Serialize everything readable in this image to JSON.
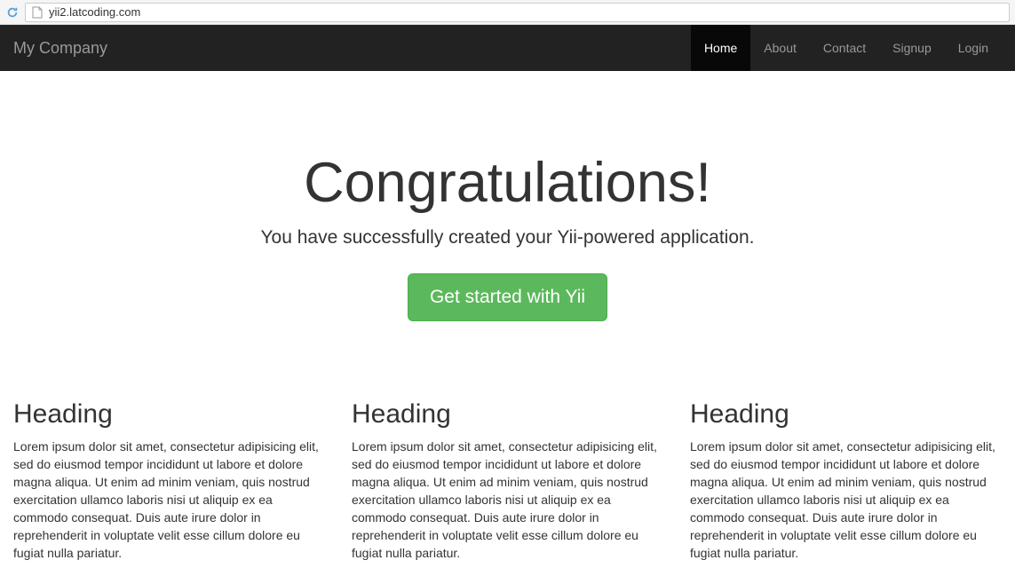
{
  "browser": {
    "url": "yii2.latcoding.com"
  },
  "navbar": {
    "brand": "My Company",
    "items": [
      {
        "label": "Home",
        "active": true
      },
      {
        "label": "About",
        "active": false
      },
      {
        "label": "Contact",
        "active": false
      },
      {
        "label": "Signup",
        "active": false
      },
      {
        "label": "Login",
        "active": false
      }
    ]
  },
  "jumbotron": {
    "title": "Congratulations!",
    "lead": "You have successfully created your Yii-powered application.",
    "cta": "Get started with Yii"
  },
  "columns": [
    {
      "heading": "Heading",
      "text": "Lorem ipsum dolor sit amet, consectetur adipisicing elit, sed do eiusmod tempor incididunt ut labore et dolore magna aliqua. Ut enim ad minim veniam, quis nostrud exercitation ullamco laboris nisi ut aliquip ex ea commodo consequat. Duis aute irure dolor in reprehenderit in voluptate velit esse cillum dolore eu fugiat nulla pariatur."
    },
    {
      "heading": "Heading",
      "text": "Lorem ipsum dolor sit amet, consectetur adipisicing elit, sed do eiusmod tempor incididunt ut labore et dolore magna aliqua. Ut enim ad minim veniam, quis nostrud exercitation ullamco laboris nisi ut aliquip ex ea commodo consequat. Duis aute irure dolor in reprehenderit in voluptate velit esse cillum dolore eu fugiat nulla pariatur."
    },
    {
      "heading": "Heading",
      "text": "Lorem ipsum dolor sit amet, consectetur adipisicing elit, sed do eiusmod tempor incididunt ut labore et dolore magna aliqua. Ut enim ad minim veniam, quis nostrud exercitation ullamco laboris nisi ut aliquip ex ea commodo consequat. Duis aute irure dolor in reprehenderit in voluptate velit esse cillum dolore eu fugiat nulla pariatur."
    }
  ]
}
